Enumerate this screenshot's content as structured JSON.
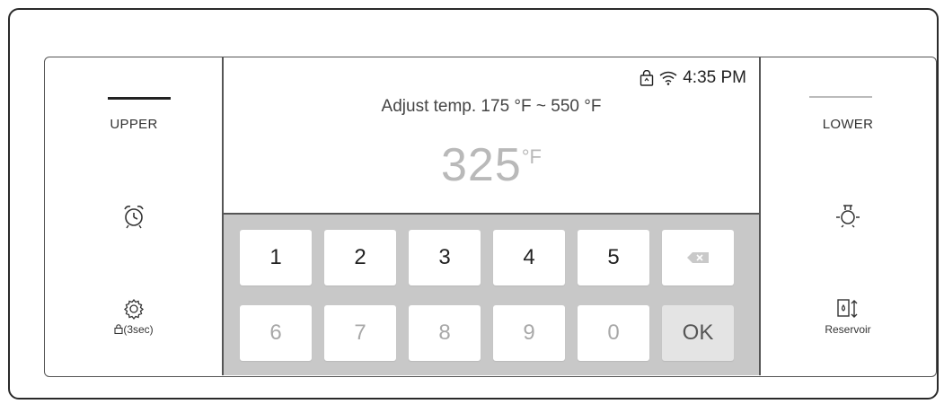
{
  "left_panel": {
    "tab_label": "UPPER",
    "timer_icon": "alarm-clock-icon",
    "settings_icon": "gear-icon",
    "settings_caption": "(3sec)"
  },
  "right_panel": {
    "tab_label": "LOWER",
    "light_icon": "light-bulb-icon",
    "reservoir_icon": "reservoir-icon",
    "reservoir_caption": "Reservoir"
  },
  "status_bar": {
    "time": "4:35 PM",
    "icons": [
      "remote-lock-icon",
      "wifi-icon"
    ]
  },
  "display": {
    "hint": "Adjust temp. 175 °F ~ 550 °F",
    "temperature_value": "325",
    "temperature_unit": "°F"
  },
  "keypad": {
    "row1": [
      "1",
      "2",
      "3",
      "4",
      "5"
    ],
    "row2": [
      "6",
      "7",
      "8",
      "9",
      "0"
    ],
    "backspace_icon": "backspace-icon",
    "ok_label": "OK"
  }
}
